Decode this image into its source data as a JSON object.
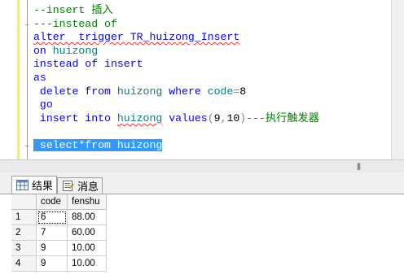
{
  "editor": {
    "lines": [
      {
        "parts": [
          {
            "t": "--insert ",
            "c": "cm"
          },
          {
            "t": "插入",
            "c": "cm cjk"
          }
        ]
      },
      {
        "parts": [
          {
            "t": "---instead of",
            "c": "cm"
          }
        ]
      },
      {
        "parts": [
          {
            "t": "alter  trigger TR_huizong_Insert",
            "c": "kw sq"
          }
        ]
      },
      {
        "parts": [
          {
            "t": "on ",
            "c": "kw"
          },
          {
            "t": "huizong",
            "c": "id"
          }
        ]
      },
      {
        "parts": [
          {
            "t": "instead of insert",
            "c": "kw"
          }
        ]
      },
      {
        "parts": [
          {
            "t": "as",
            "c": "kw"
          }
        ]
      },
      {
        "parts": [
          {
            "t": " delete from ",
            "c": "kw"
          },
          {
            "t": "huizong ",
            "c": "id"
          },
          {
            "t": "where ",
            "c": "kw"
          },
          {
            "t": "code",
            "c": "id"
          },
          {
            "t": "=",
            "c": "gr"
          },
          {
            "t": "8",
            "c": "bl"
          }
        ]
      },
      {
        "parts": [
          {
            "t": " go",
            "c": "kw"
          }
        ]
      },
      {
        "parts": [
          {
            "t": " insert into ",
            "c": "kw"
          },
          {
            "t": "huizong",
            "c": "id sq"
          },
          {
            "t": " values",
            "c": "kw"
          },
          {
            "t": "(",
            "c": "gr"
          },
          {
            "t": "9",
            "c": "bl"
          },
          {
            "t": ",",
            "c": "gr"
          },
          {
            "t": "10",
            "c": "bl"
          },
          {
            "t": ")",
            "c": "gr"
          },
          {
            "t": "---",
            "c": "cm"
          },
          {
            "t": "执行触发器",
            "c": "cm cjk"
          }
        ]
      },
      {
        "parts": []
      },
      {
        "parts": [
          {
            "t": " select*from huizong",
            "c": "sel"
          }
        ]
      }
    ],
    "hscroll_grip": "|||"
  },
  "tabs": [
    {
      "label": "结果",
      "icon": "grid-icon",
      "active": true
    },
    {
      "label": "消息",
      "icon": "message-icon",
      "active": false
    }
  ],
  "results": {
    "columns": [
      "code",
      "fenshu"
    ],
    "rows": [
      {
        "num": "1",
        "code": "6",
        "fenshu": "88.00"
      },
      {
        "num": "2",
        "code": "7",
        "fenshu": "60.00"
      },
      {
        "num": "3",
        "code": "9",
        "fenshu": "10.00"
      },
      {
        "num": "4",
        "code": "9",
        "fenshu": "10.00"
      }
    ]
  }
}
